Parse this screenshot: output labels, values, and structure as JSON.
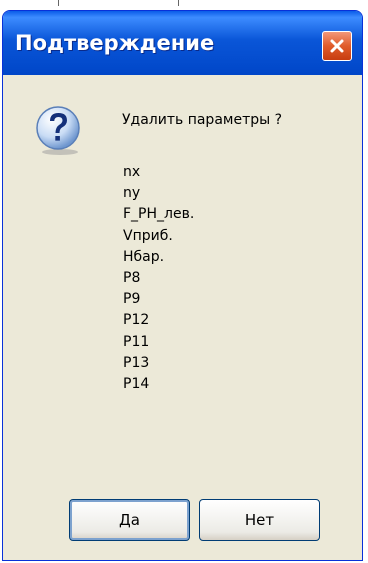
{
  "dialog": {
    "title": "Подтверждение",
    "message": "Удалить параметры ?",
    "parameters": [
      "nx",
      "ny",
      "F_PH_лев.",
      "Vприб.",
      "Hбар.",
      "P8",
      "P9",
      "P12",
      "P11",
      "P13",
      "P14"
    ],
    "buttons": {
      "yes": "Да",
      "no": "Нет"
    },
    "icons": {
      "dialog": "question-icon",
      "close": "close-icon"
    }
  },
  "colors": {
    "titlebar": "#0054e3",
    "window_bg": "#ece9d8",
    "close_button": "#e05b2a"
  }
}
